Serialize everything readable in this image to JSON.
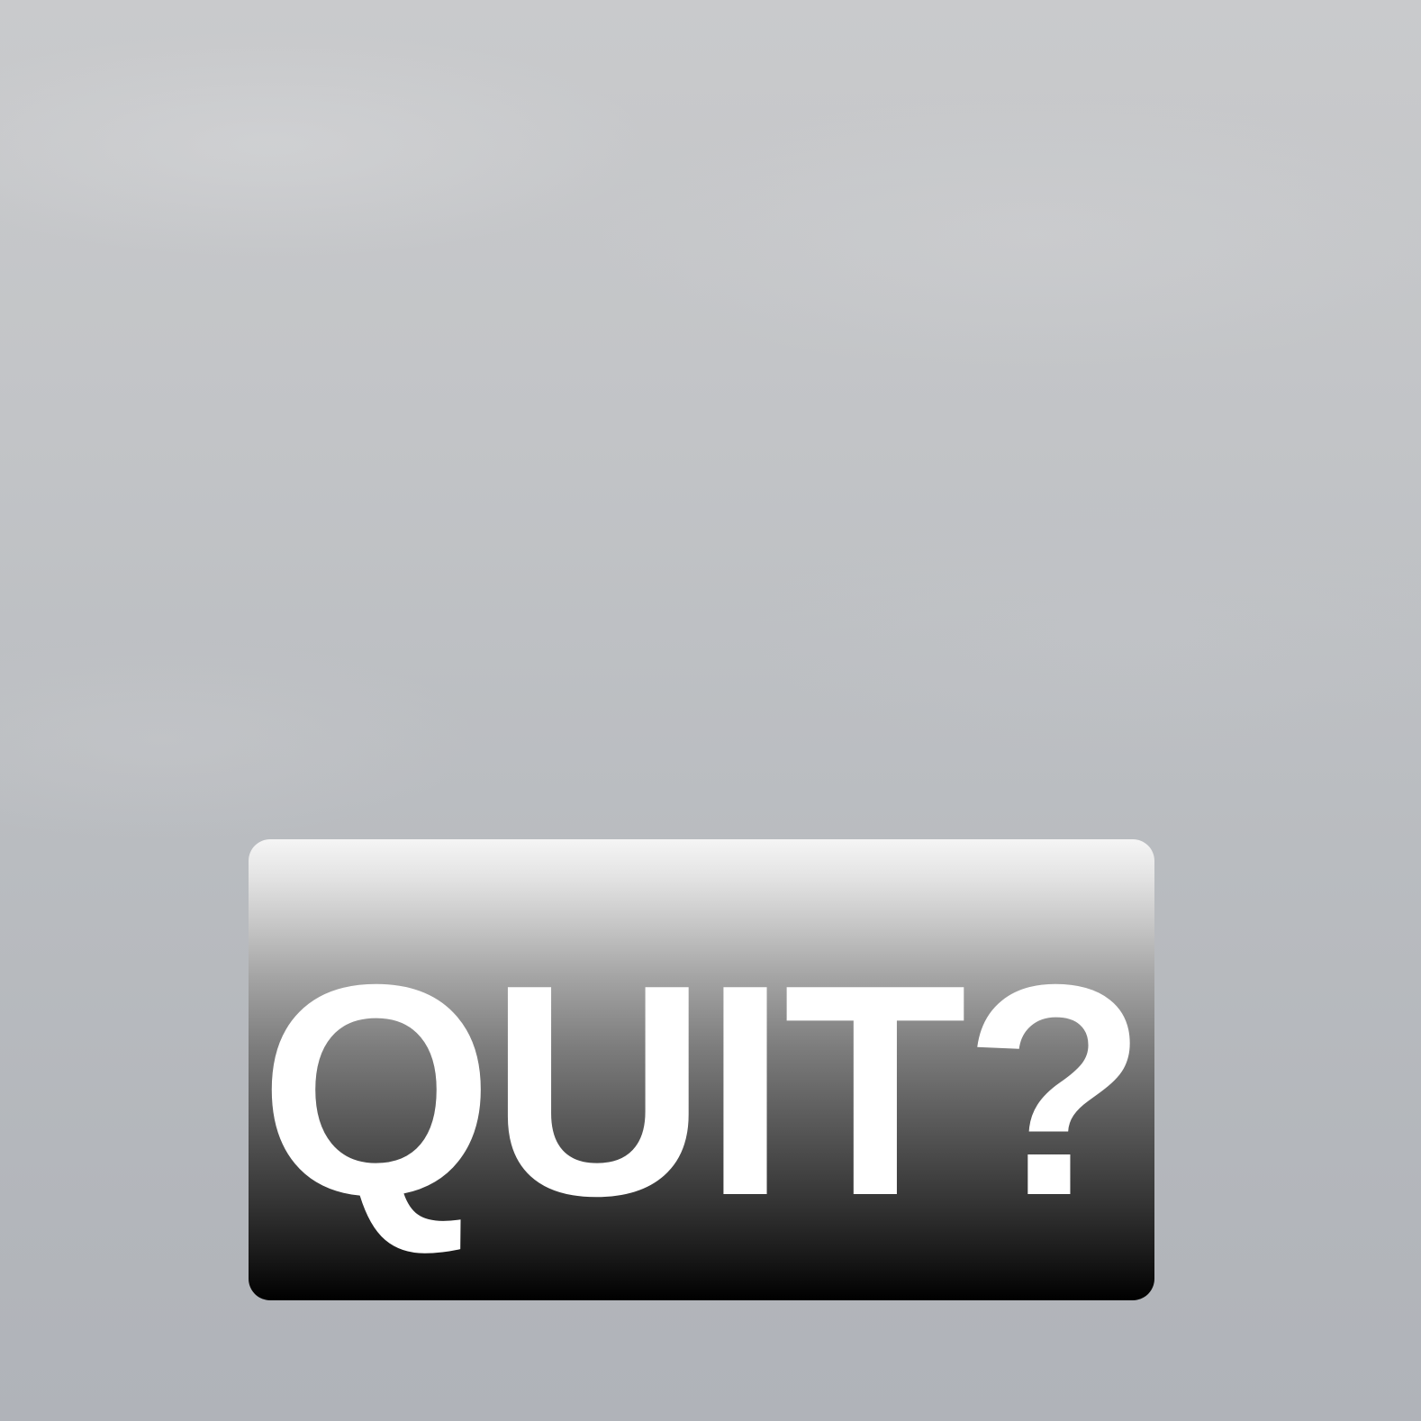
{
  "scene": {
    "background": "overcast-sky",
    "sky_color": "#c2c4c7"
  },
  "badge": {
    "text": "QUIT?",
    "text_color": "#ffffff",
    "gradient_top": "#f5f5f5",
    "gradient_bottom": "#000000"
  }
}
